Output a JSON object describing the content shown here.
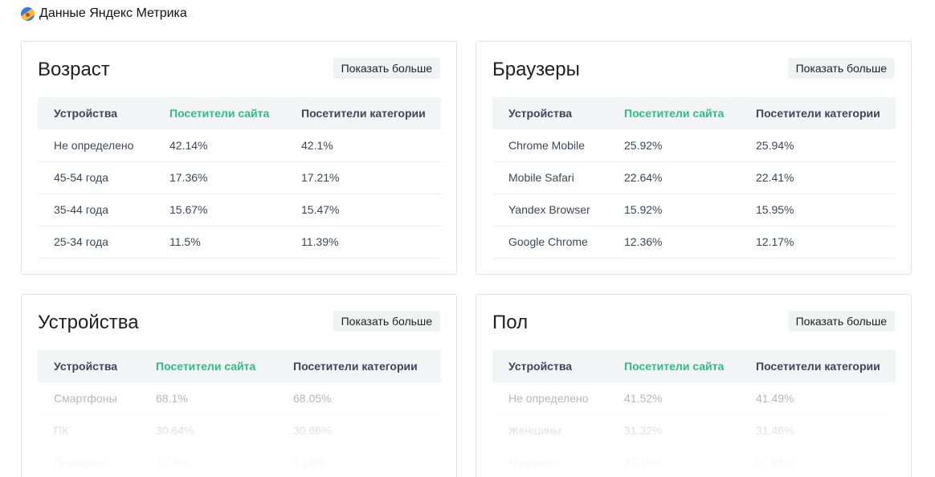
{
  "header": {
    "title": "Данные Яндекс Метрика",
    "logo_icon": "yandex-metrica-logo-icon"
  },
  "colors": {
    "accent_green": "#2ebd82",
    "header_bg": "#f3f4f6",
    "button_bg": "#f1f2f4"
  },
  "cards": [
    {
      "title": "Возраст",
      "more_label": "Показать больше",
      "columns": [
        "Устройства",
        "Посетители сайта",
        "Посетители категории"
      ],
      "rows": [
        [
          "Не определено",
          "42.14%",
          "42.1%"
        ],
        [
          "45-54 года",
          "17.36%",
          "17.21%"
        ],
        [
          "35-44 года",
          "15.67%",
          "15.47%"
        ],
        [
          "25-34 года",
          "11.5%",
          "11.39%"
        ]
      ]
    },
    {
      "title": "Браузеры",
      "more_label": "Показать больше",
      "columns": [
        "Устройства",
        "Посетители сайта",
        "Посетители категории"
      ],
      "rows": [
        [
          "Chrome Mobile",
          "25.92%",
          "25.94%"
        ],
        [
          "Mobile Safari",
          "22.64%",
          "22.41%"
        ],
        [
          "Yandex Browser",
          "15.92%",
          "15.95%"
        ],
        [
          "Google Chrome",
          "12.36%",
          "12.17%"
        ]
      ]
    },
    {
      "title": "Устройства",
      "more_label": "Показать больше",
      "columns": [
        "Устройства",
        "Посетители сайта",
        "Посетители категории"
      ],
      "rows": [
        [
          "Смартфоны",
          "68.1%",
          "68.05%"
        ],
        [
          "ПК",
          "30.64%",
          "30.66%"
        ],
        [
          "Планшеты",
          "1.23%",
          "1.26%"
        ]
      ]
    },
    {
      "title": "Пол",
      "more_label": "Показать больше",
      "columns": [
        "Устройства",
        "Посетители сайта",
        "Посетители категории"
      ],
      "rows": [
        [
          "Не определено",
          "41.52%",
          "41.49%"
        ],
        [
          "Женщины",
          "31.32%",
          "31.46%"
        ],
        [
          "Мужчины",
          "27.15%",
          "27.05%"
        ]
      ]
    }
  ]
}
